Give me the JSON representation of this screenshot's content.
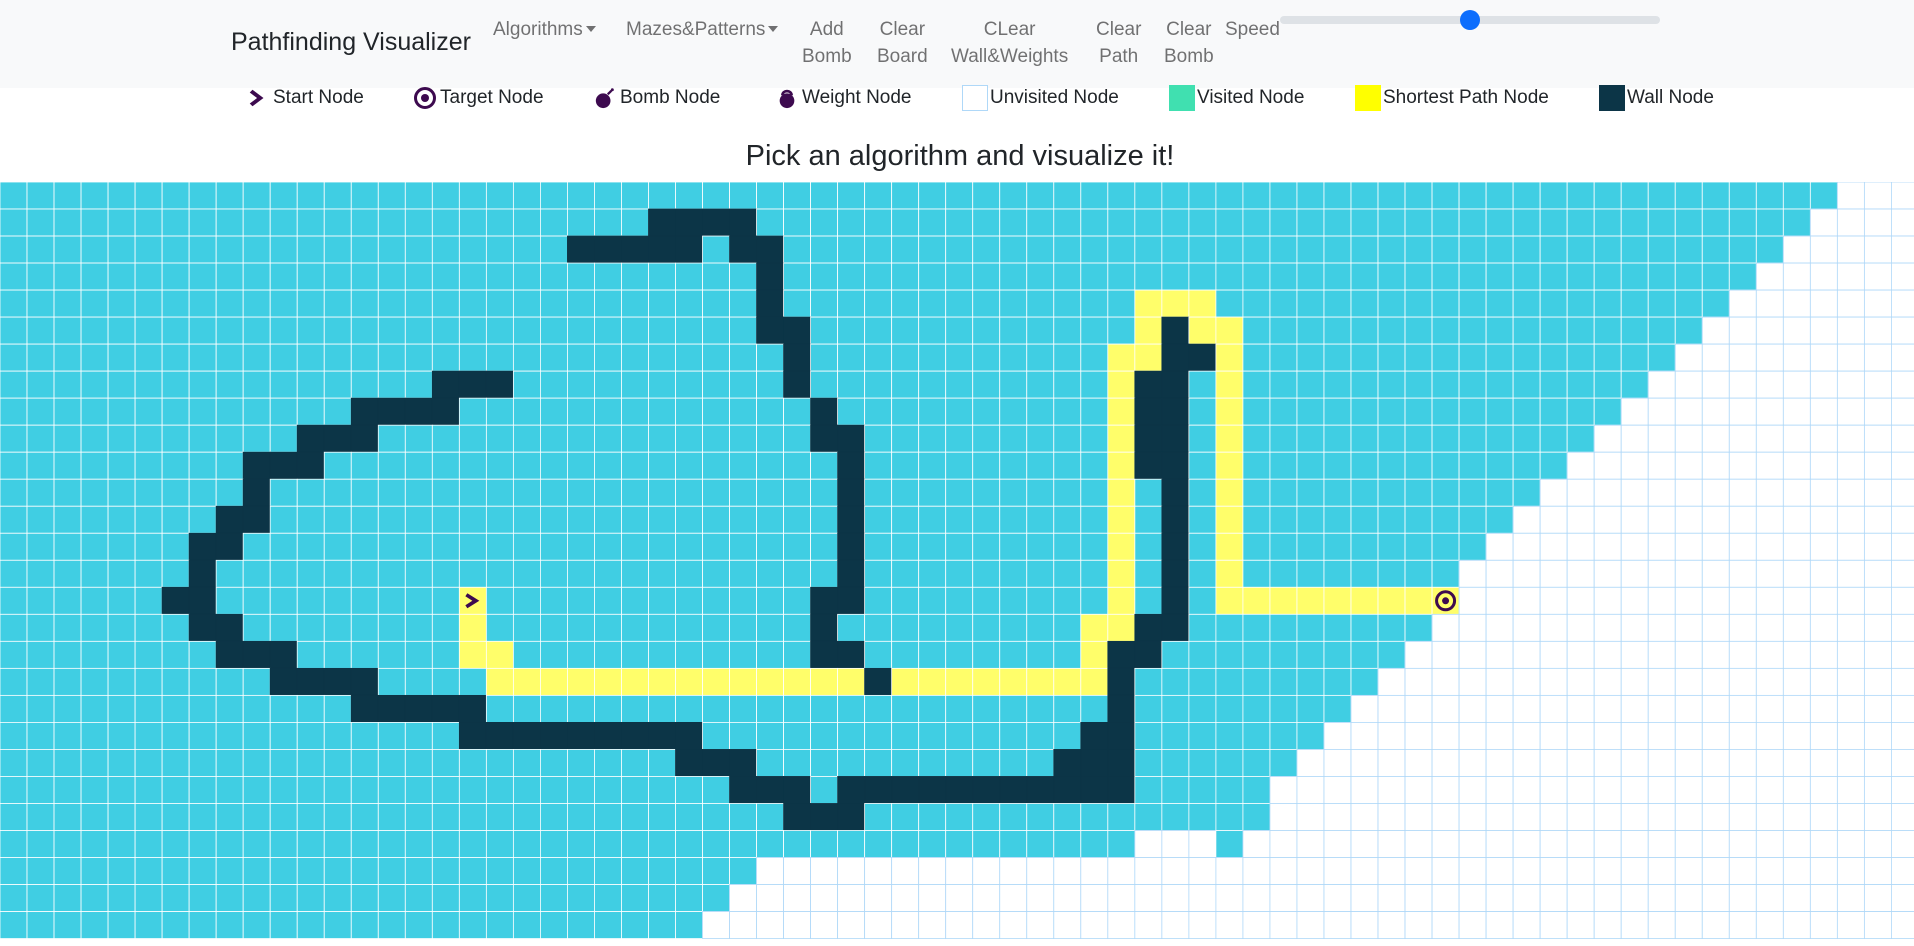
{
  "navbar": {
    "brand": "Pathfinding Visualizer",
    "algorithms": "Algorithms",
    "mazes": "Mazes&Patterns",
    "add_bomb": [
      "Add",
      "Bomb"
    ],
    "clear_board": [
      "Clear",
      "Board"
    ],
    "clear_walls": [
      "CLear",
      "Wall&Weights"
    ],
    "clear_path": [
      "Clear",
      "Path"
    ],
    "clear_bomb": [
      "Clear",
      "Bomb"
    ],
    "speed_label": "Speed",
    "speed_value": 0.5
  },
  "legend": {
    "start": "Start Node",
    "target": "Target Node",
    "bomb": "Bomb Node",
    "weight": "Weight Node",
    "unvisited": "Unvisited Node",
    "visited": "Visited Node",
    "shortest": "Shortest Path Node",
    "wall": "Wall Node"
  },
  "heading": "Pick an algorithm and visualize it!",
  "colors": {
    "visited": "#40cee3",
    "legend_visited": "#40e0b0",
    "shortest": "#fffe6a",
    "wall": "#0c3547",
    "unvisited_border": "#afd8f8",
    "icon": "#3d0a4f",
    "slider": "#0d6efd"
  },
  "grid": {
    "rows": 28,
    "cols": 71,
    "start": [
      15,
      17
    ],
    "target": [
      15,
      53
    ],
    "visited_extent": [
      67,
      66,
      65,
      64,
      63,
      62,
      61,
      60,
      59,
      58,
      57,
      56,
      55,
      54,
      53,
      53,
      52,
      51,
      50,
      49,
      48,
      47,
      46,
      44,
      41,
      27,
      26,
      25
    ],
    "visited_extra": [
      [
        23,
        41
      ],
      [
        23,
        42
      ],
      [
        23,
        43
      ],
      [
        23,
        44
      ],
      [
        23,
        45
      ],
      [
        23,
        46
      ],
      [
        24,
        45
      ]
    ],
    "walls": [
      [
        1,
        24
      ],
      [
        1,
        25
      ],
      [
        1,
        26
      ],
      [
        1,
        27
      ],
      [
        2,
        21
      ],
      [
        2,
        22
      ],
      [
        2,
        23
      ],
      [
        2,
        24
      ],
      [
        2,
        25
      ],
      [
        2,
        27
      ],
      [
        2,
        28
      ],
      [
        3,
        28
      ],
      [
        4,
        28
      ],
      [
        5,
        28
      ],
      [
        5,
        29
      ],
      [
        5,
        43
      ],
      [
        6,
        29
      ],
      [
        6,
        43
      ],
      [
        6,
        44
      ],
      [
        7,
        16
      ],
      [
        7,
        17
      ],
      [
        7,
        18
      ],
      [
        7,
        29
      ],
      [
        7,
        42
      ],
      [
        7,
        43
      ],
      [
        8,
        13
      ],
      [
        8,
        14
      ],
      [
        8,
        15
      ],
      [
        8,
        16
      ],
      [
        8,
        30
      ],
      [
        8,
        42
      ],
      [
        8,
        43
      ],
      [
        9,
        11
      ],
      [
        9,
        12
      ],
      [
        9,
        13
      ],
      [
        9,
        30
      ],
      [
        9,
        31
      ],
      [
        9,
        42
      ],
      [
        9,
        43
      ],
      [
        10,
        9
      ],
      [
        10,
        10
      ],
      [
        10,
        11
      ],
      [
        10,
        31
      ],
      [
        10,
        42
      ],
      [
        10,
        43
      ],
      [
        11,
        9
      ],
      [
        11,
        31
      ],
      [
        11,
        43
      ],
      [
        12,
        8
      ],
      [
        12,
        9
      ],
      [
        12,
        31
      ],
      [
        12,
        43
      ],
      [
        13,
        7
      ],
      [
        13,
        8
      ],
      [
        13,
        31
      ],
      [
        13,
        43
      ],
      [
        14,
        7
      ],
      [
        14,
        31
      ],
      [
        14,
        43
      ],
      [
        15,
        6
      ],
      [
        15,
        7
      ],
      [
        15,
        30
      ],
      [
        15,
        31
      ],
      [
        15,
        43
      ],
      [
        16,
        7
      ],
      [
        16,
        8
      ],
      [
        16,
        30
      ],
      [
        16,
        42
      ],
      [
        16,
        43
      ],
      [
        17,
        8
      ],
      [
        17,
        9
      ],
      [
        17,
        10
      ],
      [
        17,
        30
      ],
      [
        17,
        31
      ],
      [
        17,
        41
      ],
      [
        17,
        42
      ],
      [
        18,
        10
      ],
      [
        18,
        11
      ],
      [
        18,
        12
      ],
      [
        18,
        13
      ],
      [
        18,
        32
      ],
      [
        18,
        41
      ],
      [
        19,
        13
      ],
      [
        19,
        14
      ],
      [
        19,
        15
      ],
      [
        19,
        16
      ],
      [
        19,
        17
      ],
      [
        19,
        41
      ],
      [
        20,
        17
      ],
      [
        20,
        18
      ],
      [
        20,
        19
      ],
      [
        20,
        20
      ],
      [
        20,
        21
      ],
      [
        20,
        22
      ],
      [
        20,
        23
      ],
      [
        20,
        24
      ],
      [
        20,
        25
      ],
      [
        20,
        40
      ],
      [
        20,
        41
      ],
      [
        21,
        25
      ],
      [
        21,
        26
      ],
      [
        21,
        27
      ],
      [
        21,
        39
      ],
      [
        21,
        40
      ],
      [
        21,
        41
      ],
      [
        22,
        27
      ],
      [
        22,
        28
      ],
      [
        22,
        29
      ],
      [
        22,
        31
      ],
      [
        22,
        32
      ],
      [
        22,
        33
      ],
      [
        22,
        34
      ],
      [
        22,
        35
      ],
      [
        22,
        36
      ],
      [
        22,
        37
      ],
      [
        22,
        38
      ],
      [
        22,
        39
      ],
      [
        22,
        40
      ],
      [
        22,
        41
      ],
      [
        23,
        29
      ],
      [
        23,
        30
      ],
      [
        23,
        31
      ]
    ],
    "path": [
      [
        15,
        17
      ],
      [
        16,
        17
      ],
      [
        17,
        17
      ],
      [
        17,
        18
      ],
      [
        18,
        18
      ],
      [
        18,
        19
      ],
      [
        18,
        20
      ],
      [
        18,
        21
      ],
      [
        18,
        22
      ],
      [
        18,
        23
      ],
      [
        18,
        24
      ],
      [
        18,
        25
      ],
      [
        18,
        26
      ],
      [
        18,
        27
      ],
      [
        18,
        28
      ],
      [
        18,
        29
      ],
      [
        18,
        30
      ],
      [
        18,
        31
      ],
      [
        18,
        33
      ],
      [
        18,
        34
      ],
      [
        18,
        35
      ],
      [
        18,
        36
      ],
      [
        18,
        37
      ],
      [
        18,
        38
      ],
      [
        18,
        39
      ],
      [
        18,
        40
      ],
      [
        17,
        40
      ],
      [
        16,
        40
      ],
      [
        16,
        41
      ],
      [
        15,
        41
      ],
      [
        14,
        41
      ],
      [
        13,
        41
      ],
      [
        12,
        41
      ],
      [
        11,
        41
      ],
      [
        10,
        41
      ],
      [
        9,
        41
      ],
      [
        8,
        41
      ],
      [
        7,
        41
      ],
      [
        6,
        41
      ],
      [
        6,
        42
      ],
      [
        5,
        42
      ],
      [
        4,
        42
      ],
      [
        4,
        43
      ],
      [
        4,
        44
      ],
      [
        5,
        44
      ],
      [
        5,
        45
      ],
      [
        6,
        45
      ],
      [
        7,
        45
      ],
      [
        8,
        45
      ],
      [
        9,
        45
      ],
      [
        10,
        45
      ],
      [
        11,
        45
      ],
      [
        12,
        45
      ],
      [
        13,
        45
      ],
      [
        14,
        45
      ],
      [
        15,
        45
      ],
      [
        15,
        46
      ],
      [
        15,
        47
      ],
      [
        15,
        48
      ],
      [
        15,
        49
      ],
      [
        15,
        50
      ],
      [
        15,
        51
      ],
      [
        15,
        52
      ],
      [
        15,
        53
      ]
    ]
  }
}
